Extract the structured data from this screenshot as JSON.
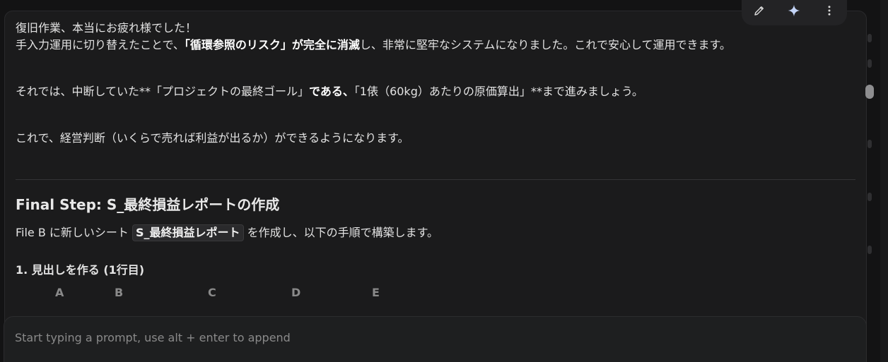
{
  "message": {
    "paragraph1": {
      "line1": "復旧作業、本当にお疲れ様でした！",
      "line2_pre": "手入力運用に切り替えたことで、",
      "line2_bold": "「循環参照のリスク」が完全に消滅",
      "line2_post": "し、非常に堅牢なシステムになりました。これで安心して運用できます。"
    },
    "paragraph2": {
      "pre": "それでは、中断していた**「プロジェクトの最終ゴール」",
      "bold": "である、",
      "post": "「1俵（60kg）あたりの原価算出」**まで進みましょう。"
    },
    "paragraph3": "これで、経営判断（いくらで売れば利益が出るか）ができるようになります。",
    "heading": "Final Step: S_最終損益レポートの作成",
    "paragraph4": {
      "pre": "File B に新しいシート ",
      "code": "S_最終損益レポート",
      "post": " を作成し、以下の手順で構築します。"
    },
    "subheading": "1. 見出しを作る (1行目)",
    "columns": [
      "A",
      "B",
      "C",
      "D",
      "E"
    ]
  },
  "toolbar": {
    "edit_icon": "pencil-icon",
    "ai_icon": "sparkle-icon",
    "more_icon": "more-vertical-icon"
  },
  "prompt": {
    "placeholder": "Start typing a prompt, use alt + enter to append"
  },
  "colors": {
    "background": "#131314",
    "message_bg": "#1b1b1c",
    "accent": "#8ab4f8"
  }
}
